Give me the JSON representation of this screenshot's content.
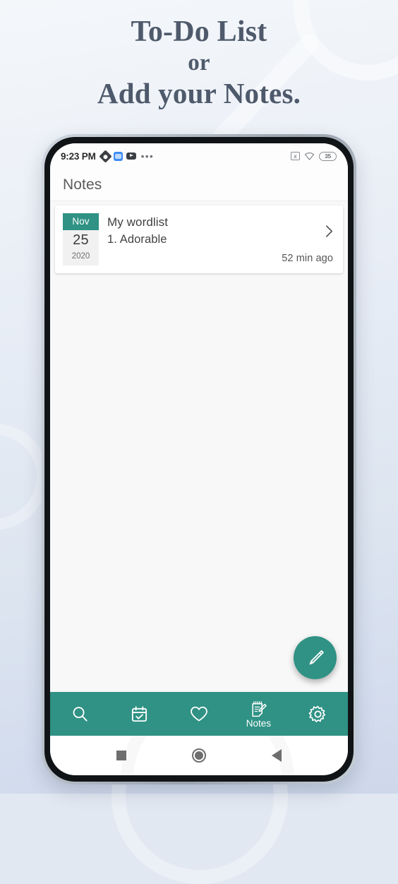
{
  "promo": {
    "headline_line1": "To-Do List",
    "headline_line2": "or",
    "headline_line3": "Add your Notes.",
    "accent_color": "#2f9284",
    "headline_color": "#4e5a6b",
    "background_color": "#e2e8f2"
  },
  "status_bar": {
    "time": "9:23 PM",
    "app_icons": [
      "sync-app-icon",
      "blue-app-icon",
      "video-app-icon"
    ],
    "overflow": "•••",
    "no_sim_label": "x",
    "battery_level": "35"
  },
  "app_bar": {
    "title": "Notes"
  },
  "notes": [
    {
      "month": "Nov",
      "day": "25",
      "year": "2020",
      "title": "My wordlist",
      "subtitle": "1. Adorable",
      "time_ago": "52 min ago"
    }
  ],
  "fab": {
    "icon": "pencil-icon"
  },
  "bottom_nav": {
    "items": [
      {
        "icon": "search-icon",
        "label": "",
        "active": false
      },
      {
        "icon": "calendar-check-icon",
        "label": "",
        "active": false
      },
      {
        "icon": "heart-icon",
        "label": "",
        "active": false
      },
      {
        "icon": "notes-icon",
        "label": "Notes",
        "active": true
      },
      {
        "icon": "gear-icon",
        "label": "",
        "active": false
      }
    ]
  },
  "android_nav": {
    "recents": "square-icon",
    "home": "circle-icon",
    "back": "triangle-back-icon"
  }
}
